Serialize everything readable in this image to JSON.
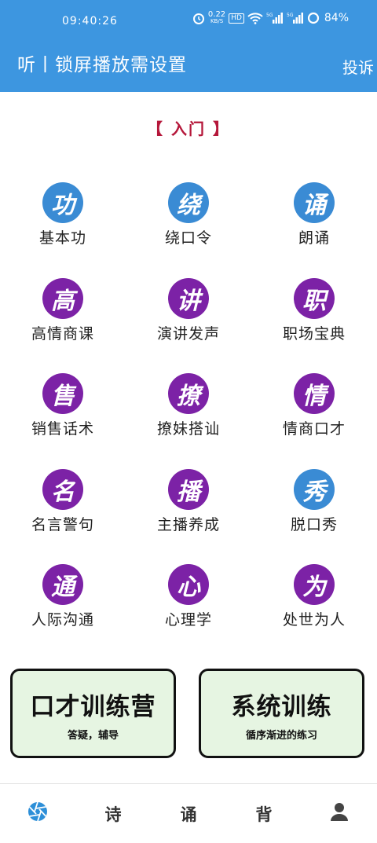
{
  "status_bar": {
    "time": "09:40:26",
    "speed_value": "0.22",
    "speed_unit": "KB/S",
    "hd": "HD",
    "signal1": "5G",
    "signal2": "5G",
    "battery": "84%"
  },
  "header": {
    "title": "听丨锁屏播放需设置",
    "complain_label": "投诉"
  },
  "section": {
    "title": "【 入门 】"
  },
  "categories": [
    {
      "glyph": "功",
      "label": "基本功",
      "color": "blue"
    },
    {
      "glyph": "绕",
      "label": "绕口令",
      "color": "blue"
    },
    {
      "glyph": "诵",
      "label": "朗诵",
      "color": "blue"
    },
    {
      "glyph": "高",
      "label": "高情商课",
      "color": "purple"
    },
    {
      "glyph": "讲",
      "label": "演讲发声",
      "color": "purple"
    },
    {
      "glyph": "职",
      "label": "职场宝典",
      "color": "purple"
    },
    {
      "glyph": "售",
      "label": "销售话术",
      "color": "purple"
    },
    {
      "glyph": "撩",
      "label": "撩妹搭讪",
      "color": "purple"
    },
    {
      "glyph": "情",
      "label": "情商口才",
      "color": "purple"
    },
    {
      "glyph": "名",
      "label": "名言警句",
      "color": "purple"
    },
    {
      "glyph": "播",
      "label": "主播养成",
      "color": "purple"
    },
    {
      "glyph": "秀",
      "label": "脱口秀",
      "color": "blue"
    },
    {
      "glyph": "通",
      "label": "人际沟通",
      "color": "purple"
    },
    {
      "glyph": "心",
      "label": "心理学",
      "color": "purple"
    },
    {
      "glyph": "为",
      "label": "处世为人",
      "color": "purple"
    }
  ],
  "promo": {
    "left": {
      "title": "口才训练营",
      "subtitle": "答疑，辅导"
    },
    "right": {
      "title": "系统训练",
      "subtitle": "循序渐进的练习"
    }
  },
  "bottom_nav": {
    "home_icon": "aperture-icon",
    "tab2": "诗",
    "tab3": "诵",
    "tab4": "背",
    "profile_icon": "user-icon"
  },
  "colors": {
    "header_bg": "#3d96e0",
    "badge_blue": "#3a8bd4",
    "badge_purple": "#7c22a6",
    "section_title": "#b5173a",
    "card_bg": "#e6f5e2"
  }
}
